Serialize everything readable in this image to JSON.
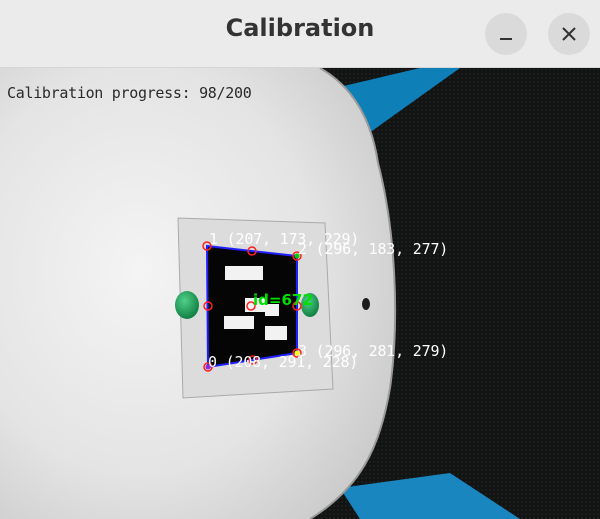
{
  "window": {
    "title": "Calibration",
    "minimize_icon": "minimize-icon",
    "close_icon": "close-icon"
  },
  "overlay": {
    "progress_text": "Calibration progress: 98/200",
    "marker_id_label": "id=672",
    "corners": [
      {
        "label": "0 (208, 291, 228)"
      },
      {
        "label": "1 (207, 173, 229)"
      },
      {
        "label": "2 (296, 183, 277)"
      },
      {
        "label": "3 (296, 281, 279)"
      }
    ]
  },
  "colors": {
    "titlebar": "#ebebeb",
    "marker_outline": "#2020ff",
    "corner_circle": "#ff2020",
    "id_text": "#00e000",
    "label_text": "#ffffff"
  }
}
